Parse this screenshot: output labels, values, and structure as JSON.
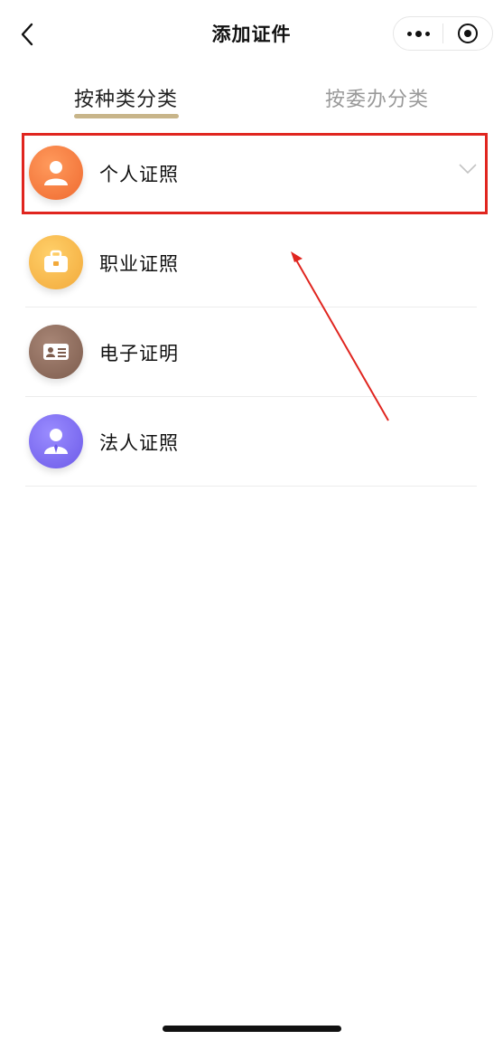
{
  "header": {
    "title": "添加证件",
    "back_icon": "chevron-left-icon",
    "more_icon": "more-dots-icon",
    "close_icon": "target-close-icon"
  },
  "tabs": [
    {
      "label": "按种类分类",
      "active": true
    },
    {
      "label": "按委办分类",
      "active": false
    }
  ],
  "items": [
    {
      "label": "个人证照",
      "icon": "person-icon",
      "color": "#f27a3f",
      "expanded_indicator": "chevron-down-icon",
      "highlighted": true
    },
    {
      "label": "职业证照",
      "icon": "briefcase-icon",
      "color": "#f5b74a"
    },
    {
      "label": "电子证明",
      "icon": "id-card-icon",
      "color": "#8c6a5a"
    },
    {
      "label": "法人证照",
      "icon": "business-person-icon",
      "color": "#7b6cf0"
    }
  ],
  "colors": {
    "tab_underline": "#c8b58a",
    "annotation_red": "#e0251f"
  }
}
